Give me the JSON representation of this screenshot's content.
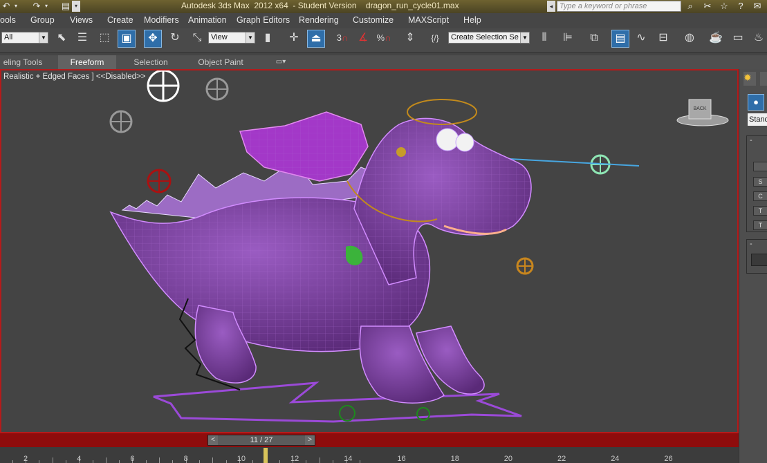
{
  "title_bar": {
    "title": "Autodesk 3ds Max  2012 x64  - Student Version    dragon_run_cycle01.max",
    "search_placeholder": "Type a keyword or phrase",
    "quick_access_icons": [
      "undo-icon",
      "redo-icon",
      "open-file-icon"
    ],
    "right_icons": [
      "binoculars-icon",
      "tools-icon",
      "star-icon",
      "help-icon"
    ]
  },
  "menu_bar": {
    "items": [
      "ools",
      "Group",
      "Views",
      "Create",
      "Modifiers",
      "Animation",
      "Graph Editors",
      "Rendering",
      "Customize",
      "MAXScript",
      "Help"
    ]
  },
  "toolbar": {
    "selection_filter": "All",
    "reference_coord": "View",
    "snap_angle_label": "3",
    "snap_percent_label": "%",
    "named_selection_placeholder": "Create Selection Se",
    "icons": [
      "select-object-icon",
      "select-by-name-icon",
      "rectangle-selection-icon",
      "window-crossing-icon",
      "move-icon",
      "rotate-icon",
      "scale-icon",
      "pivot-center-icon",
      "select-manipulate-icon",
      "keyboard-shortcut-icon",
      "snaps-toggle-icon",
      "angle-snap-icon",
      "percent-snap-icon",
      "spinner-snap-icon",
      "edit-named-selection-icon",
      "mirror-icon",
      "align-icon",
      "layer-manager-icon",
      "graphite-toggle-icon",
      "curve-editor-icon",
      "schematic-view-icon",
      "material-editor-icon",
      "render-setup-icon",
      "rendered-frame-icon",
      "render-production-icon"
    ]
  },
  "ribbon": {
    "tabs": [
      "eling Tools",
      "Freeform",
      "Selection",
      "Object Paint"
    ],
    "selected_tab": "Freeform"
  },
  "viewport": {
    "label": "Realistic + Edged Faces ] <<Disabled>>",
    "viewcube_label": "BACK",
    "border_color": "#b51b1b",
    "dragon_color": "#7a3f9e"
  },
  "timeline": {
    "frame_display": "11 / 27",
    "prev_label": "<",
    "next_label": ">",
    "current_frame": 11,
    "total_frames": 27,
    "ruler_labels": [
      "2",
      "4",
      "6",
      "8",
      "10",
      "12",
      "14",
      "16",
      "18",
      "20",
      "22",
      "24",
      "26"
    ]
  },
  "command_panel": {
    "dropdown_text": "Stand",
    "rollout_minus": "-",
    "buttons": [
      "S",
      "C",
      "T",
      "T"
    ]
  }
}
